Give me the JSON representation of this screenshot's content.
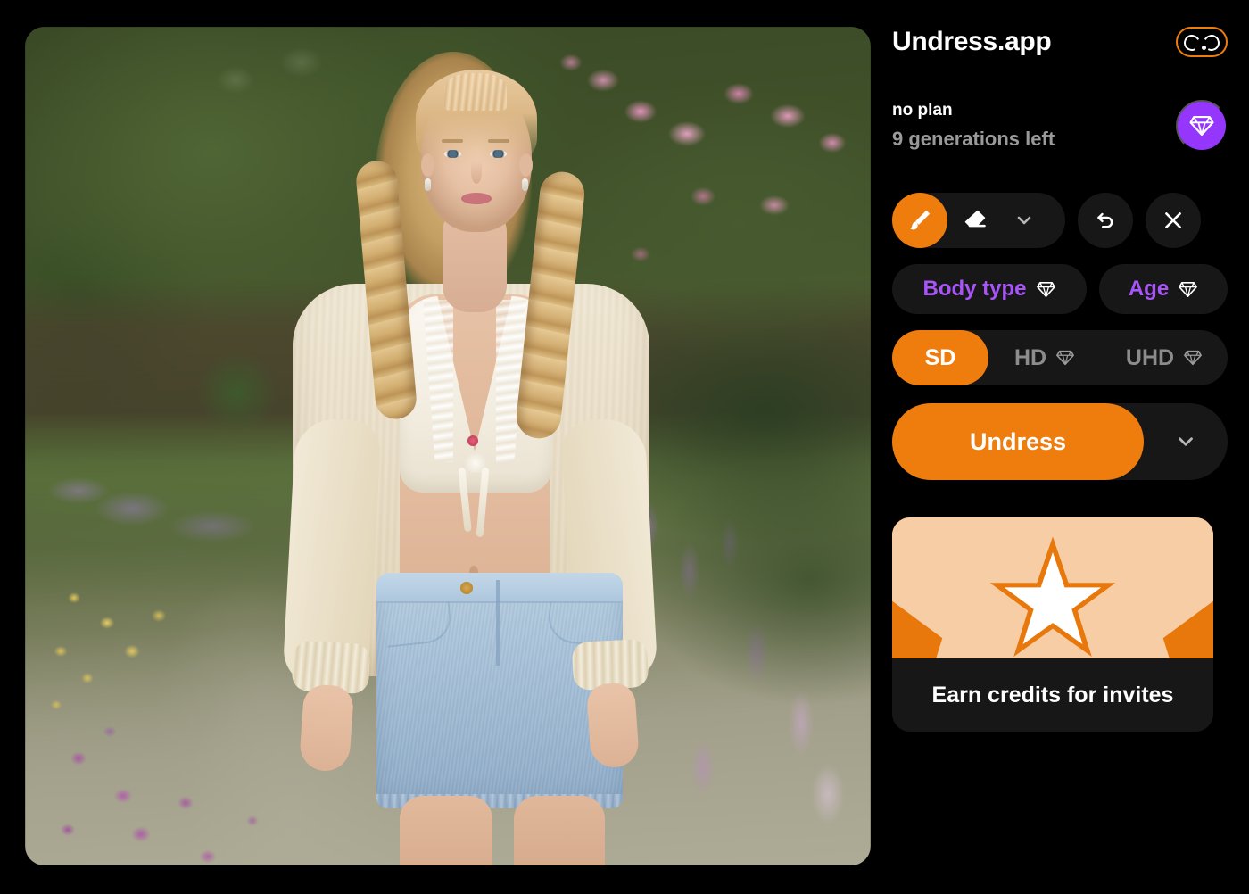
{
  "app": {
    "title": "Undress.app",
    "logo_icon": "undress-logo-icon",
    "accent_orange": "#ef7d0e",
    "accent_purple": "#9436fb",
    "panel_surface": "#171717",
    "background": "#000000"
  },
  "account": {
    "plan": "no plan",
    "generations_left": "9 generations left",
    "upgrade_icon": "diamond-icon"
  },
  "tools": {
    "brush": {
      "label": "brush-tool",
      "icon": "brush-icon",
      "active": true
    },
    "eraser": {
      "label": "eraser-tool",
      "icon": "eraser-icon",
      "active": false
    },
    "size_dropdown_icon": "chevron-down-icon",
    "undo": {
      "label": "undo",
      "icon": "undo-arrow-icon"
    },
    "close": {
      "label": "close",
      "icon": "close-x-icon"
    }
  },
  "attributes": [
    {
      "label": "Body type",
      "icon": "diamond-icon",
      "premium": true
    },
    {
      "label": "Age",
      "icon": "diamond-icon",
      "premium": true
    }
  ],
  "quality": {
    "selected": "SD",
    "options": [
      {
        "label": "SD",
        "premium": false,
        "selected": true
      },
      {
        "label": "HD",
        "premium": true,
        "icon": "diamond-icon",
        "selected": false
      },
      {
        "label": "UHD",
        "premium": true,
        "icon": "diamond-icon",
        "selected": false
      }
    ]
  },
  "cta": {
    "label": "Undress",
    "dropdown_icon": "chevron-down-icon"
  },
  "promo": {
    "label": "Earn credits for invites",
    "art_icon": "starburst-icon",
    "art_bg": "#e8770c",
    "art_ray": "#f5c79a"
  },
  "canvas": {
    "name": "source-photo",
    "description": "Photo of a blonde woman with braided hair wearing a cream cardigan, white lace crop top and light blue denim skirt, walking on a stone garden path lined with purple and yellow wildflowers, pink flowering shrubs and hedges in background."
  }
}
